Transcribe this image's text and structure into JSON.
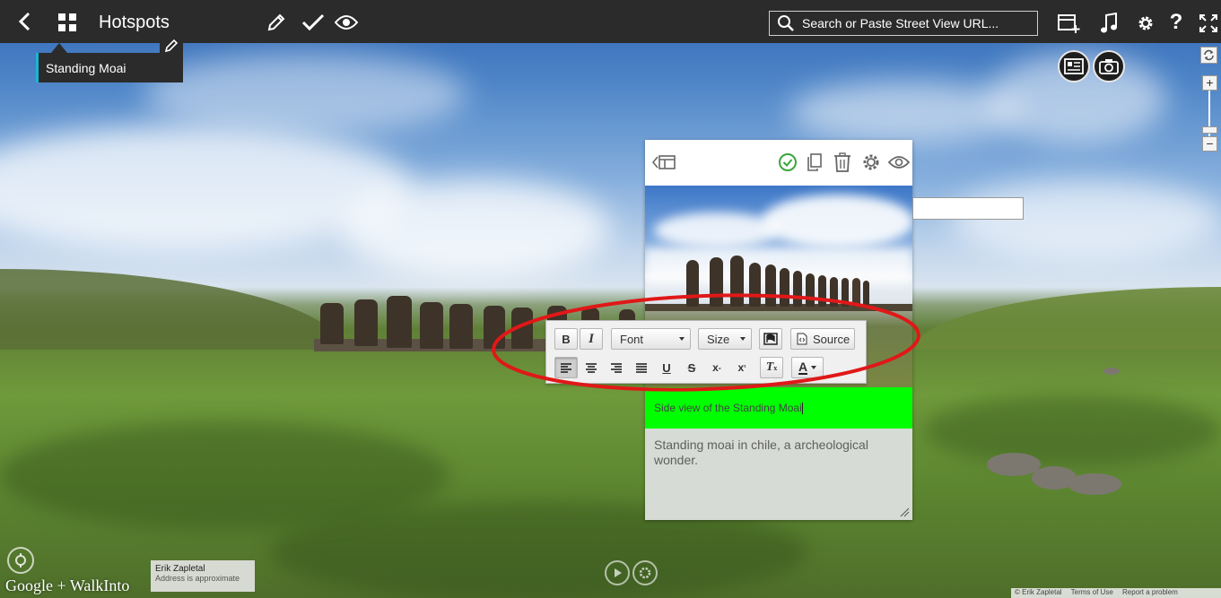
{
  "header": {
    "title": "Hotspots",
    "search_placeholder": "Search or Paste Street View URL..."
  },
  "hotspot": {
    "label": "Standing Moai"
  },
  "card": {
    "title_text": "Side view of the Standing Moai",
    "description": "Standing moai in chile, a archeological wonder."
  },
  "editor": {
    "font_label": "Font",
    "size_label": "Size",
    "source_label": "Source"
  },
  "footer": {
    "logo_text": "Google + WalkInto",
    "author_name": "Erik Zapletal",
    "address_note": "Address is approximate",
    "copyright": "© Erik Zapletal",
    "terms": "Terms of Use",
    "report": "Report a problem"
  },
  "colors": {
    "topbar_bg": "#2b2b2b",
    "accent_green": "#00ff00",
    "hotspot_accent": "#19b6d6",
    "annotation_red": "#e01818",
    "check_green": "#3aa63a"
  },
  "icons": [
    "back-arrow-icon",
    "grid-icon",
    "pencil-icon",
    "check-icon",
    "eye-icon",
    "search-icon",
    "add-panel-icon",
    "music-icon",
    "gear-icon",
    "help-icon",
    "fullscreen-icon",
    "info-card-icon",
    "camera-icon",
    "sync-icon",
    "layout-toggle-icon",
    "copy-icon",
    "trash-icon",
    "compass-icon"
  ]
}
